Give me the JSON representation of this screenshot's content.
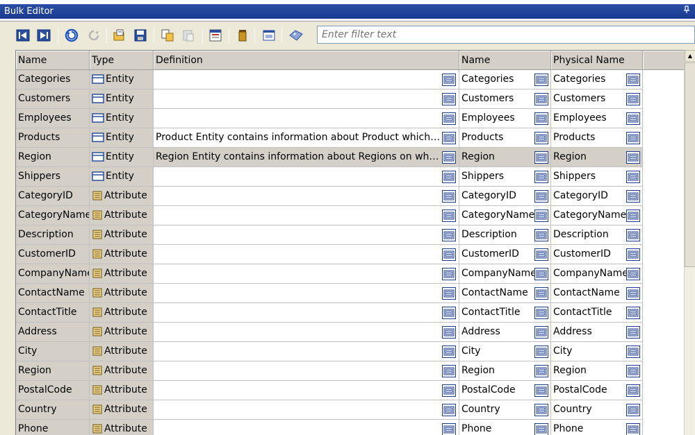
{
  "window": {
    "title": "Bulk Editor"
  },
  "filter": {
    "placeholder": "Enter filter text"
  },
  "columns": {
    "name": "Name",
    "type": "Type",
    "definition": "Definition",
    "name2": "Name",
    "physical_name": "Physical Name"
  },
  "rows": [
    {
      "name": "Categories",
      "type": "Entity",
      "definition": "",
      "name2": "Categories",
      "physical": "Categories"
    },
    {
      "name": "Customers",
      "type": "Entity",
      "definition": "",
      "name2": "Customers",
      "physical": "Customers"
    },
    {
      "name": "Employees",
      "type": "Entity",
      "definition": "",
      "name2": "Employees",
      "physical": "Employees"
    },
    {
      "name": "Products",
      "type": "Entity",
      "definition": "Product Entity contains information about Product which our ...",
      "name2": "Products",
      "physical": "Products"
    },
    {
      "name": "Region",
      "type": "Entity",
      "definition": "Region Entity contains information about Regions on which o...",
      "name2": "Region",
      "physical": "Region"
    },
    {
      "name": "Shippers",
      "type": "Entity",
      "definition": "",
      "name2": "Shippers",
      "physical": "Shippers"
    },
    {
      "name": "CategoryID",
      "type": "Attribute",
      "definition": "",
      "name2": "CategoryID",
      "physical": "CategoryID"
    },
    {
      "name": "CategoryName",
      "type": "Attribute",
      "definition": "",
      "name2": "CategoryName",
      "physical": "CategoryName"
    },
    {
      "name": "Description",
      "type": "Attribute",
      "definition": "",
      "name2": "Description",
      "physical": "Description"
    },
    {
      "name": "CustomerID",
      "type": "Attribute",
      "definition": "",
      "name2": "CustomerID",
      "physical": "CustomerID"
    },
    {
      "name": "CompanyName",
      "type": "Attribute",
      "definition": "",
      "name2": "CompanyName",
      "physical": "CompanyName"
    },
    {
      "name": "ContactName",
      "type": "Attribute",
      "definition": "",
      "name2": "ContactName",
      "physical": "ContactName"
    },
    {
      "name": "ContactTitle",
      "type": "Attribute",
      "definition": "",
      "name2": "ContactTitle",
      "physical": "ContactTitle"
    },
    {
      "name": "Address",
      "type": "Attribute",
      "definition": "",
      "name2": "Address",
      "physical": "Address"
    },
    {
      "name": "City",
      "type": "Attribute",
      "definition": "",
      "name2": "City",
      "physical": "City"
    },
    {
      "name": "Region",
      "type": "Attribute",
      "definition": "",
      "name2": "Region",
      "physical": "Region"
    },
    {
      "name": "PostalCode",
      "type": "Attribute",
      "definition": "",
      "name2": "PostalCode",
      "physical": "PostalCode"
    },
    {
      "name": "Country",
      "type": "Attribute",
      "definition": "",
      "name2": "Country",
      "physical": "Country"
    },
    {
      "name": "Phone",
      "type": "Attribute",
      "definition": "",
      "name2": "Phone",
      "physical": "Phone"
    }
  ],
  "selected_row": 4,
  "toolbar": {
    "icons": [
      "first-record-icon",
      "last-record-icon",
      "undo-icon",
      "redo-icon",
      "open-icon",
      "save-icon",
      "copy-icon",
      "paste-icon",
      "properties-icon",
      "delete-icon",
      "view-icon",
      "tag-icon"
    ]
  },
  "colors": {
    "title_bar": "#1a3a90",
    "chrome": "#ece9d8",
    "header": "#d4d0c8",
    "button_border": "#1c3b8c"
  }
}
